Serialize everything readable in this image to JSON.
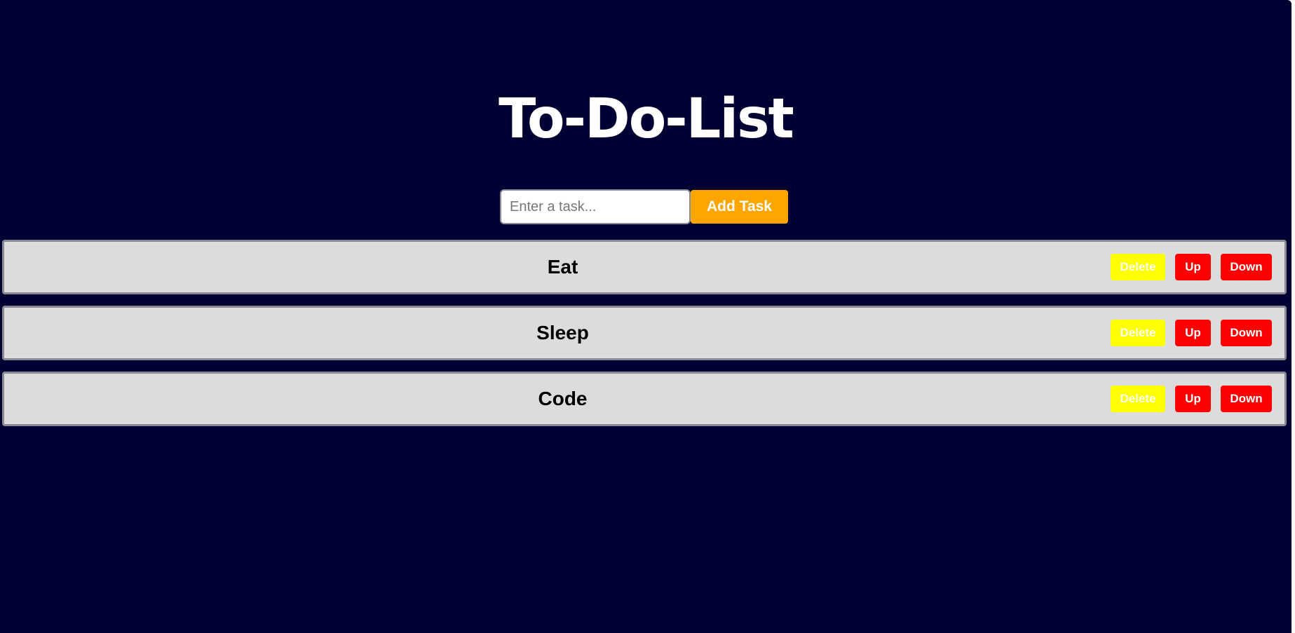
{
  "app": {
    "title": "To-Do-List"
  },
  "input": {
    "placeholder": "Enter a task...",
    "value": ""
  },
  "add_button": {
    "label": "Add Task"
  },
  "tasks": [
    {
      "label": "Eat",
      "delete_label": "Delete",
      "up_label": "Up",
      "down_label": "Down"
    },
    {
      "label": "Sleep",
      "delete_label": "Delete",
      "up_label": "Up",
      "down_label": "Down"
    },
    {
      "label": "Code",
      "delete_label": "Delete",
      "up_label": "Up",
      "down_label": "Down"
    }
  ],
  "colors": {
    "background": "#000033",
    "title_text": "#ffffff",
    "add_button": "#ffa500",
    "task_row": "#dcdcdc",
    "delete_button": "#ffff00",
    "move_buttons": "#ff0000"
  }
}
